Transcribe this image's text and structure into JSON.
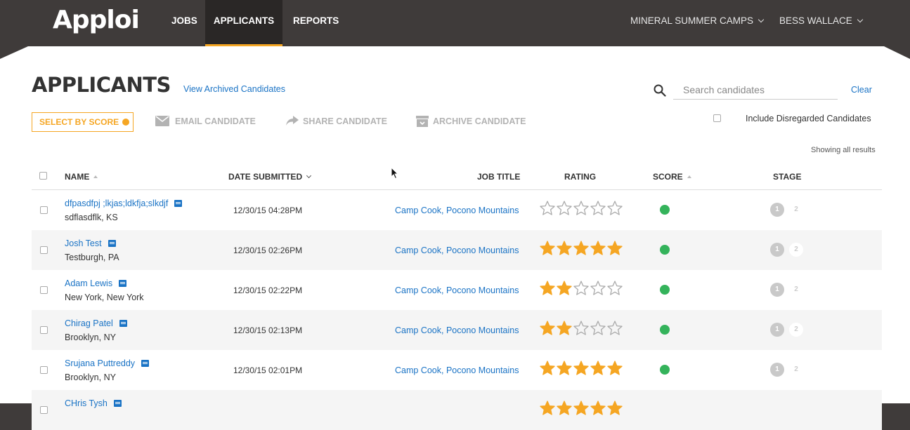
{
  "nav": {
    "logo": "Apploi",
    "jobs": "JOBS",
    "applicants": "APPLICANTS",
    "reports": "REPORTS",
    "organization": "MINERAL SUMMER CAMPS",
    "user": "BESS WALLACE"
  },
  "page": {
    "title": "APPLICANTS",
    "archived_link": "View Archived Candidates"
  },
  "search": {
    "placeholder": "Search candidates",
    "value": "",
    "clear_label": "Clear"
  },
  "toolbar": {
    "select_by_score": "SELECT BY SCORE",
    "email": "EMAIL CANDIDATE",
    "share": "SHARE CANDIDATE",
    "archive": "ARCHIVE CANDIDATE"
  },
  "filters": {
    "include_disregarded": "Include Disregarded Candidates",
    "include_disregarded_checked": false
  },
  "results_text": "Showing all results",
  "table": {
    "headers": {
      "name": "NAME",
      "date": "DATE SUBMITTED",
      "job": "JOB TITLE",
      "rating": "RATING",
      "score": "SCORE",
      "stage": "STAGE"
    },
    "rows": [
      {
        "name": "dfpasdfpj ;lkjas;ldkfja;slkdjf",
        "location": "sdflasdflk, KS",
        "date": "12/30/15 04:28PM",
        "job": "Camp Cook, Pocono Mountains",
        "rating": 0,
        "score_color": "#34b35b",
        "stage_a": "1",
        "stage_b": "2"
      },
      {
        "name": "Josh Test",
        "location": "Testburgh, PA",
        "date": "12/30/15 02:26PM",
        "job": "Camp Cook, Pocono Mountains",
        "rating": 5,
        "score_color": "#34b35b",
        "stage_a": "1",
        "stage_b": "2"
      },
      {
        "name": "Adam Lewis",
        "location": "New York, New York",
        "date": "12/30/15 02:22PM",
        "job": "Camp Cook, Pocono Mountains",
        "rating": 2,
        "score_color": "#34b35b",
        "stage_a": "1",
        "stage_b": "2"
      },
      {
        "name": "Chirag Patel",
        "location": "Brooklyn, NY",
        "date": "12/30/15 02:13PM",
        "job": "Camp Cook, Pocono Mountains",
        "rating": 2,
        "score_color": "#34b35b",
        "stage_a": "1",
        "stage_b": "2"
      },
      {
        "name": "Srujana Puttreddy",
        "location": "Brooklyn, NY",
        "date": "12/30/15 02:01PM",
        "job": "Camp Cook, Pocono Mountains",
        "rating": 5,
        "score_color": "#34b35b",
        "stage_a": "1",
        "stage_b": "2"
      },
      {
        "name": "CHris Tysh",
        "location": "",
        "date": "",
        "job": "",
        "rating": 5,
        "score_color": "",
        "stage_a": "",
        "stage_b": ""
      }
    ]
  },
  "colors": {
    "brand_orange": "#f5a623",
    "link_blue": "#1a73c5",
    "score_green": "#34b35b",
    "header_dark": "#3f3b3a"
  }
}
